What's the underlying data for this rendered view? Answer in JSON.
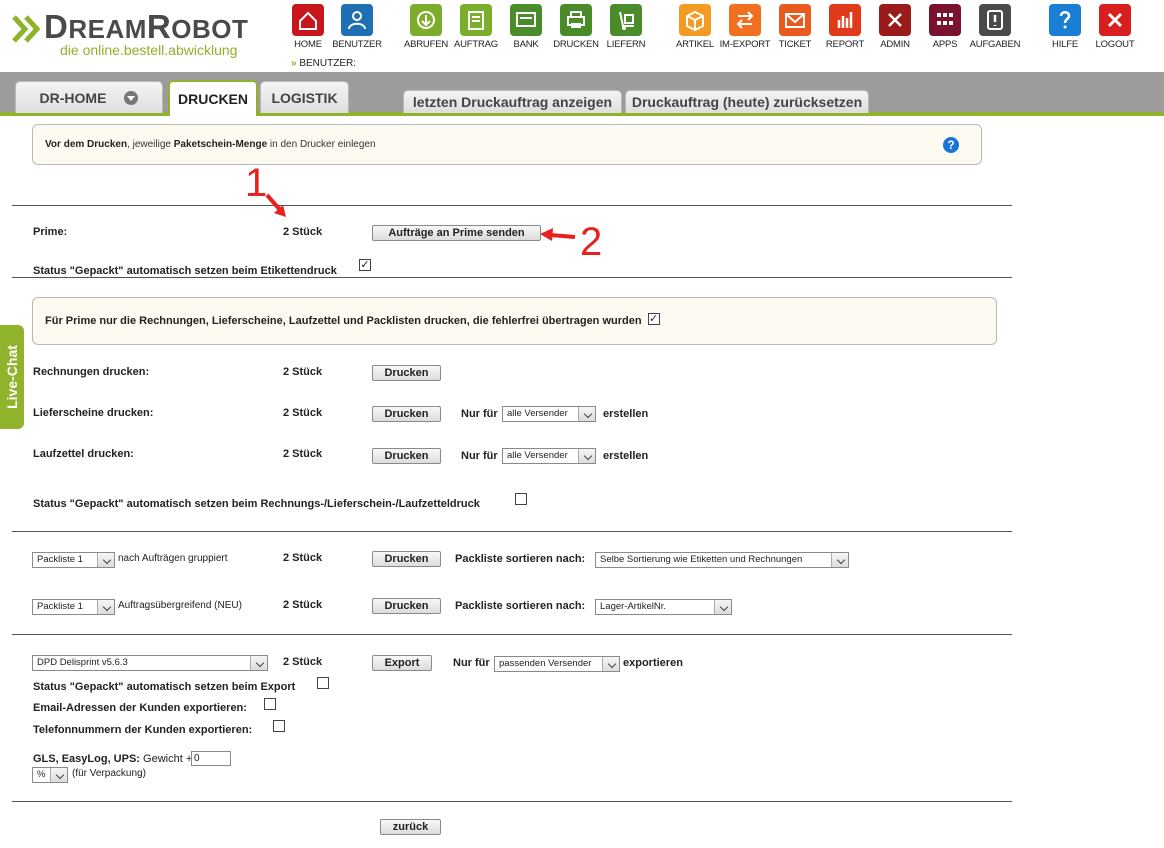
{
  "logo": {
    "name_big_1": "D",
    "name_small_1": "REAM",
    "name_big_2": "R",
    "name_small_2": "OBOT",
    "tagline": "die online.bestell.abwicklung"
  },
  "nav": [
    {
      "id": "home",
      "label": "HOME",
      "icon": "home-icon",
      "color": "#c8161d"
    },
    {
      "id": "benutzer",
      "label": "BENUTZER",
      "icon": "user-icon",
      "color": "#1f6fb5"
    },
    {
      "id": "abrufen",
      "label": "ABRUFEN",
      "icon": "download-icon",
      "color": "#7cae2b"
    },
    {
      "id": "auftrag",
      "label": "AUFTRAG",
      "icon": "order-icon",
      "color": "#7cae2b"
    },
    {
      "id": "bank",
      "label": "BANK",
      "icon": "bank-icon",
      "color": "#4a8c2a"
    },
    {
      "id": "drucken",
      "label": "DRUCKEN",
      "icon": "printer-icon",
      "color": "#4a8c2a"
    },
    {
      "id": "liefern",
      "label": "LIEFERN",
      "icon": "dolly-icon",
      "color": "#4a8c2a"
    },
    {
      "id": "artikel",
      "label": "ARTIKEL",
      "icon": "box-icon",
      "color": "#f59a23"
    },
    {
      "id": "im-export",
      "label": "IM-EXPORT",
      "icon": "exchange-icon",
      "color": "#f07020"
    },
    {
      "id": "ticket",
      "label": "TICKET",
      "icon": "mail-icon",
      "color": "#ea5a1c"
    },
    {
      "id": "report",
      "label": "REPORT",
      "icon": "chart-icon",
      "color": "#e03a1a"
    },
    {
      "id": "admin",
      "label": "ADMIN",
      "icon": "tools-icon",
      "color": "#9b1a1a"
    },
    {
      "id": "apps",
      "label": "APPS",
      "icon": "apps-icon",
      "color": "#7a1230"
    },
    {
      "id": "aufgaben",
      "label": "AUFGABEN",
      "icon": "task-icon",
      "color": "#4a4a4a"
    },
    {
      "id": "hilfe",
      "label": "HILFE",
      "icon": "help-icon",
      "color": "#1a7fd4"
    },
    {
      "id": "logout",
      "label": "LOGOUT",
      "icon": "logout-icon",
      "color": "#d81e1e"
    }
  ],
  "user_label": "BENUTZER:",
  "tabs": {
    "home": "DR-HOME",
    "drucken": "DRUCKEN",
    "logistik": "LOGISTIK",
    "last_job": "letzten Druckauftrag anzeigen",
    "reset_job": "Druckauftrag (heute) zurücksetzen"
  },
  "info1": {
    "p1": "Vor dem Drucken",
    "p2": ", jeweilige ",
    "p3": "Paketschein-Menge",
    "p4": " in den Drucker einlegen"
  },
  "prime": {
    "label": "Prime:",
    "count": "2 Stück",
    "send_button": "Aufträge an Prime senden",
    "status_label": "Status \"Gepackt\" automatisch setzen beim Etikettendruck",
    "status_checked": "✓"
  },
  "info2": {
    "text": "Für Prime nur die Rechnungen, Lieferscheine, Laufzettel und Packlisten drucken, die fehlerfrei übertragen wurden",
    "checked": "✓"
  },
  "print_rows": {
    "rechnungen": {
      "label": "Rechnungen drucken:",
      "count": "2 Stück",
      "button": "Drucken"
    },
    "lieferscheine": {
      "label": "Lieferscheine drucken:",
      "count": "2 Stück",
      "button": "Drucken",
      "nur_fuer": "Nur für",
      "select": "alle Versender",
      "erstellen": "erstellen"
    },
    "laufzettel": {
      "label": "Laufzettel drucken:",
      "count": "2 Stück",
      "button": "Drucken",
      "nur_fuer": "Nur für",
      "select": "alle Versender",
      "erstellen": "erstellen"
    },
    "status_label": "Status \"Gepackt\" automatisch setzen beim Rechnungs-/Lieferschein-/Laufzetteldruck",
    "status_checked": ""
  },
  "packlisten": [
    {
      "select": "Packliste 1",
      "desc": "nach Aufträgen gruppiert",
      "count": "2 Stück",
      "button": "Drucken",
      "sort_label": "Packliste sortieren nach:",
      "sort_select": "Selbe Sortierung wie Etiketten und Rechnungen"
    },
    {
      "select": "Packliste 1",
      "desc": "Auftragsübergreifend (NEU)",
      "count": "2 Stück",
      "button": "Drucken",
      "sort_label": "Packliste sortieren nach:",
      "sort_select": "Lager-ArtikelNr."
    }
  ],
  "export": {
    "select": "DPD Delisprint v5.6.3",
    "count": "2 Stück",
    "button": "Export",
    "nur_fuer": "Nur für",
    "versender_select": "passenden Versender",
    "exportieren": "exportieren",
    "status_label": "Status \"Gepackt\" automatisch setzen beim Export",
    "email_label": "Email-Adressen der Kunden exportieren:",
    "phone_label": "Telefonnummern der Kunden exportieren:",
    "gls_bold": "GLS, EasyLog, UPS:",
    "gls_text": " Gewicht +",
    "gls_value": "0",
    "unit_select": "%",
    "verpackung": "(für Verpackung)"
  },
  "back_button": "zurück",
  "livechat": "Live-Chat",
  "annotations": {
    "one": "1",
    "two": "2"
  },
  "colors": {
    "brand_green": "#8fb32a",
    "tabbar_gray": "#9c9c9c",
    "annotation_red": "#e8211e",
    "info_bg": "#fdfaf2"
  }
}
